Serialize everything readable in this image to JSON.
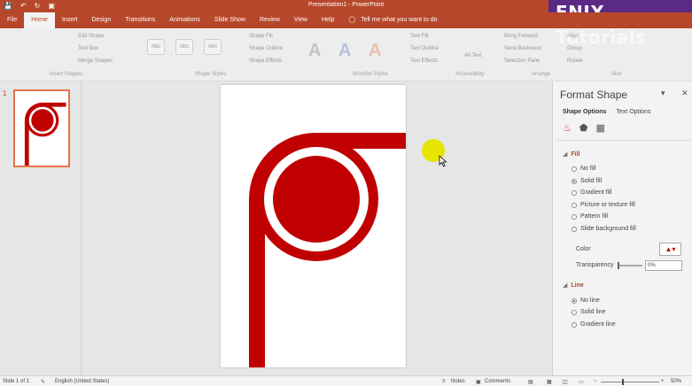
{
  "app": {
    "title": "Presentation1  -  PowerPoint",
    "watermark": "ENIX Tutorials"
  },
  "quick_access": {
    "save_icon": "save-icon",
    "undo_icon": "undo-icon",
    "redo_icon": "redo-icon",
    "present_icon": "slideshow-icon"
  },
  "tabs": [
    "File",
    "Home",
    "Insert",
    "Design",
    "Transitions",
    "Animations",
    "Slide Show",
    "Review",
    "View",
    "Help"
  ],
  "active_tab": "Home",
  "tell_me": "Tell me what you want to do",
  "ribbon": {
    "edit_shape": "Edit Shape",
    "text_box": "Text Box",
    "merge_shapes": "Merge Shapes",
    "insert_shapes": "Insert Shapes",
    "shape_styles": "Shape Styles",
    "shape_fill": "Shape Fill",
    "shape_outline": "Shape Outline",
    "shape_effects": "Shape Effects",
    "wordart_styles": "WordArt Styles",
    "text_fill": "Text Fill",
    "text_outline": "Text Outline",
    "text_effects": "Text Effects",
    "alt_text": "Alt Text",
    "accessibility": "Accessibility",
    "bring_forward": "Bring Forward",
    "send_backward": "Send Backward",
    "selection_pane": "Selection Pane",
    "align": "Align",
    "group": "Group",
    "rotate": "Rotate",
    "arrange": "Arrange",
    "size": "Size",
    "abc1": "Abc",
    "abc2": "Abc",
    "abc3": "Abc",
    "wordart_a": "A"
  },
  "thumbnails": {
    "slide_number": "1"
  },
  "format_pane": {
    "title": "Format Shape",
    "dropdown_icon": "chevron-down-icon",
    "close_icon": "close-icon",
    "tab_shape": "Shape Options",
    "tab_text": "Text Options",
    "fill_section": "Fill",
    "fill_options": [
      {
        "label": "No fill",
        "selected": false
      },
      {
        "label": "Solid fill",
        "selected": true
      },
      {
        "label": "Gradient fill",
        "selected": false
      },
      {
        "label": "Picture or texture fill",
        "selected": false
      },
      {
        "label": "Pattern fill",
        "selected": false
      },
      {
        "label": "Slide background fill",
        "selected": false
      }
    ],
    "color_label": "Color",
    "transparency_label": "Transparency",
    "transparency_value": "0%",
    "line_section": "Line",
    "line_options": [
      {
        "label": "No line",
        "selected": true
      },
      {
        "label": "Solid line",
        "selected": false
      },
      {
        "label": "Gradient line",
        "selected": false
      }
    ]
  },
  "status": {
    "slide": "Slide 1 of 1",
    "language": "English (United States)",
    "notes": "Notes",
    "comments": "Comments",
    "zoom": "50%"
  },
  "colors": {
    "accent": "#b7472a",
    "shape_red": "#c00000",
    "highlight_yellow": "#e7e400"
  }
}
